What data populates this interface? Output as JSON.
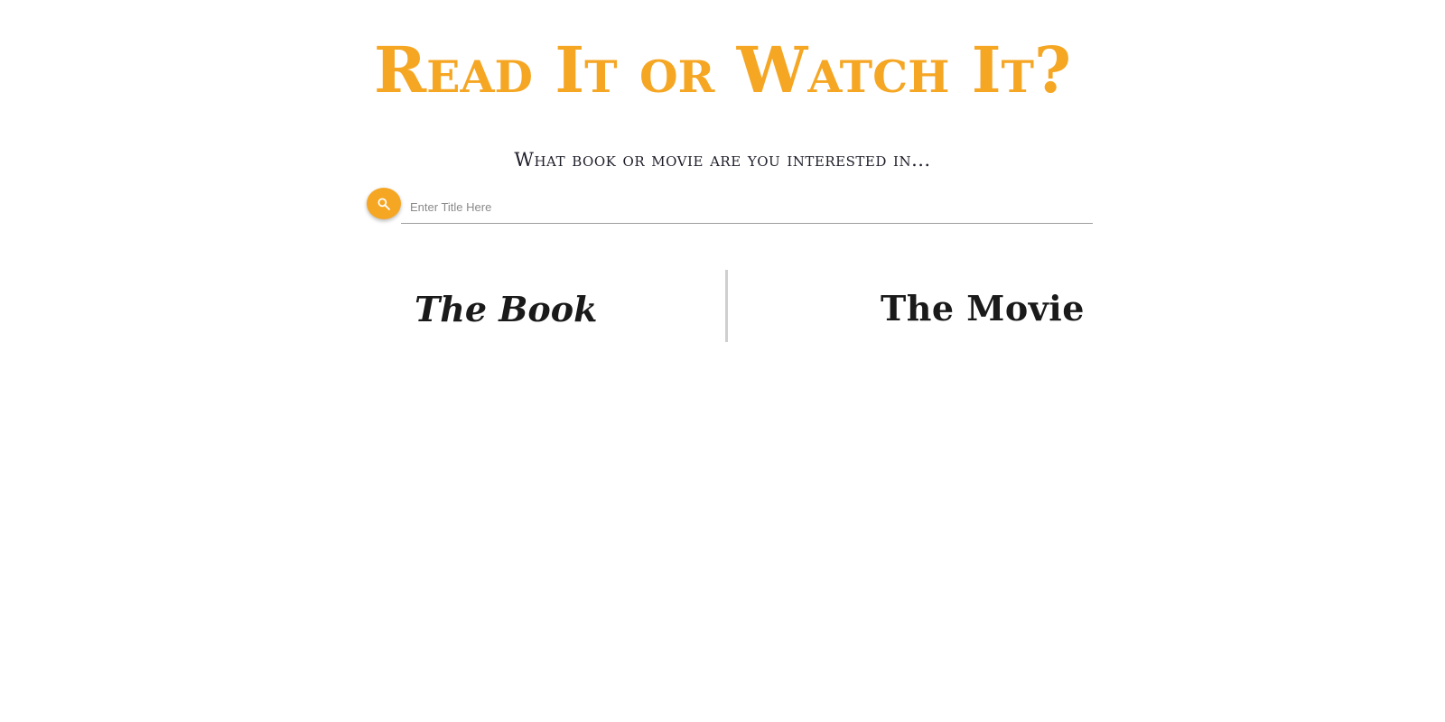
{
  "header": {
    "title": "Read It or Watch It?",
    "prompt": "What book or movie are you interested in..."
  },
  "search": {
    "placeholder": "Enter Title Here",
    "value": "",
    "button_icon": "search-icon",
    "accent_color": "#f5a623"
  },
  "results": {
    "book_heading": "The Book",
    "movie_heading": "The Movie"
  }
}
